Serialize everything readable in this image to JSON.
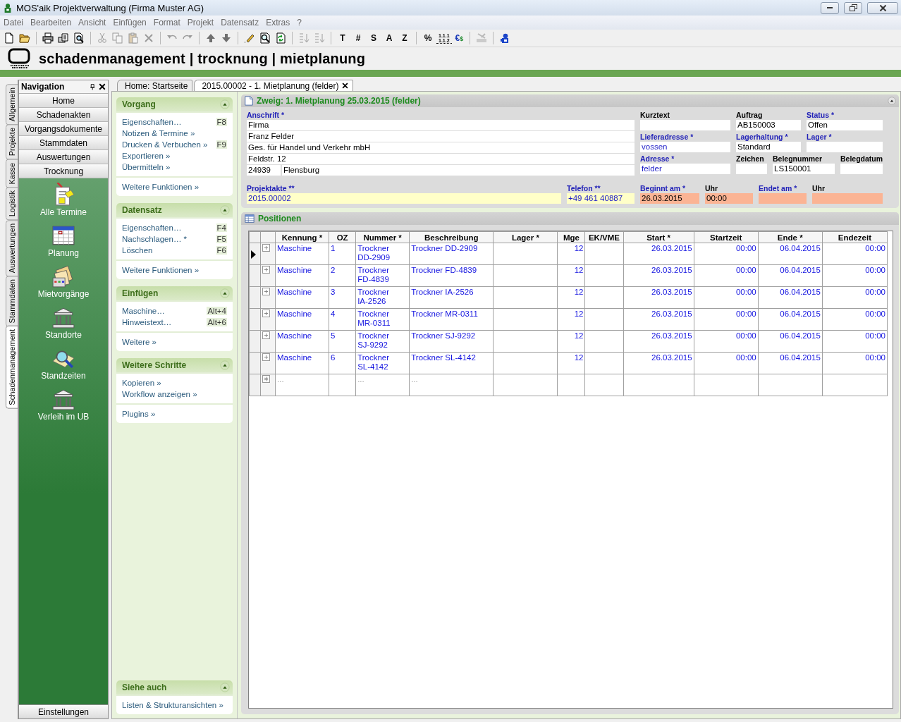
{
  "window": {
    "title": "MOS'aik Projektverwaltung (Firma Muster AG)"
  },
  "menu": [
    "Datei",
    "Bearbeiten",
    "Ansicht",
    "Einfügen",
    "Format",
    "Projekt",
    "Datensatz",
    "Extras",
    "?"
  ],
  "toolbar": [
    {
      "kind": "icon",
      "disabled": false
    },
    {
      "kind": "icon",
      "disabled": false
    },
    {
      "kind": "separator"
    },
    {
      "kind": "icon",
      "disabled": false
    },
    {
      "kind": "icon",
      "disabled": false
    },
    {
      "kind": "icon",
      "disabled": false
    },
    {
      "kind": "separator"
    },
    {
      "kind": "icon",
      "disabled": true
    },
    {
      "kind": "icon",
      "disabled": true
    },
    {
      "kind": "icon",
      "disabled": true
    },
    {
      "kind": "icon",
      "disabled": true
    },
    {
      "kind": "separator"
    },
    {
      "kind": "icon",
      "disabled": true
    },
    {
      "kind": "icon",
      "disabled": true
    },
    {
      "kind": "separator"
    },
    {
      "kind": "icon",
      "disabled": false
    },
    {
      "kind": "icon",
      "disabled": false
    },
    {
      "kind": "separator"
    },
    {
      "kind": "icon",
      "disabled": false
    },
    {
      "kind": "icon",
      "disabled": false
    },
    {
      "kind": "icon",
      "disabled": false
    },
    {
      "kind": "separator"
    },
    {
      "kind": "icon",
      "disabled": true
    },
    {
      "kind": "icon",
      "disabled": true
    },
    {
      "kind": "separator"
    },
    {
      "kind": "label",
      "text": "T",
      "disabled": false
    },
    {
      "kind": "label",
      "text": "#",
      "disabled": false
    },
    {
      "kind": "label",
      "text": "S",
      "disabled": false
    },
    {
      "kind": "label",
      "text": "A",
      "disabled": false
    },
    {
      "kind": "label",
      "text": "Z",
      "disabled": false
    },
    {
      "kind": "separator"
    },
    {
      "kind": "label",
      "text": "%",
      "disabled": false
    },
    {
      "kind": "stack",
      "lines": [
        "1.1.1",
        "1.1.2"
      ],
      "disabled": false
    },
    {
      "kind": "pair",
      "parts": [
        "€",
        "$"
      ],
      "disabled": false
    },
    {
      "kind": "separator"
    },
    {
      "kind": "icon",
      "disabled": true
    },
    {
      "kind": "separator"
    },
    {
      "kind": "icon",
      "disabled": false
    }
  ],
  "banner": {
    "title": "schadenmanagement | trocknung | mietplanung"
  },
  "side_tabs": [
    {
      "label": "Allgemein",
      "selected": false
    },
    {
      "label": "Projekte",
      "selected": false
    },
    {
      "label": "Kasse",
      "selected": false
    },
    {
      "label": "Logistik",
      "selected": false
    },
    {
      "label": "Auswertungen",
      "selected": false
    },
    {
      "label": "Stammdaten",
      "selected": false
    },
    {
      "label": "Schadenmanagement",
      "selected": true
    }
  ],
  "navigation": {
    "title": "Navigation",
    "buttons": [
      "Home",
      "Schadenakten",
      "Vorgangsdokumente",
      "Stammdaten",
      "Auswertungen",
      "Trocknung"
    ],
    "items": [
      "Alle Termine",
      "Planung",
      "Mietvorgänge",
      "Standorte",
      "Standzeiten",
      "Verleih im UB"
    ],
    "footer_button": "Einstellungen"
  },
  "doc_tabs": [
    {
      "label": "Home: Startseite",
      "selected": false
    },
    {
      "label": "2015.00002 - 1. Mietplanung (felder)",
      "selected": true
    }
  ],
  "taskpane": {
    "sections": [
      {
        "title": "Vorgang",
        "groups": [
          [
            {
              "label": "Eigenschaften…",
              "shortcut": "F8"
            },
            {
              "label": "Notizen & Termine »"
            },
            {
              "label": "Drucken & Verbuchen »",
              "shortcut": "F9"
            },
            {
              "label": "Exportieren »"
            },
            {
              "label": "Übermitteln »"
            }
          ],
          [
            {
              "label": "Weitere Funktionen »"
            }
          ]
        ]
      },
      {
        "title": "Datensatz",
        "groups": [
          [
            {
              "label": "Eigenschaften…",
              "shortcut": "F4"
            },
            {
              "label": "Nachschlagen… *",
              "shortcut": "F5"
            },
            {
              "label": "Löschen",
              "shortcut": "F6"
            }
          ],
          [
            {
              "label": "Weitere Funktionen »"
            }
          ]
        ]
      },
      {
        "title": "Einfügen",
        "groups": [
          [
            {
              "label": "Maschine…",
              "shortcut": "Alt+4"
            },
            {
              "label": "Hinweistext…",
              "shortcut": "Alt+6"
            }
          ],
          [
            {
              "label": "Weitere »"
            }
          ]
        ]
      },
      {
        "title": "Weitere Schritte",
        "groups": [
          [
            {
              "label": "Kopieren »"
            },
            {
              "label": "Workflow anzeigen »"
            }
          ],
          [
            {
              "label": "Plugins »"
            }
          ]
        ]
      }
    ],
    "footer_section": {
      "title": "Siehe auch",
      "groups": [
        [
          {
            "label": "Listen & Strukturansichten »"
          }
        ]
      ]
    }
  },
  "form": {
    "title": "Zweig: 1. Mietplanung 25.03.2015 (felder)",
    "address": {
      "label": "Anschrift *",
      "required": true,
      "lines": [
        "Firma",
        "Franz Felder",
        "Ges. für Handel und Verkehr mbH",
        "Feldstr. 12"
      ],
      "postcode": "24939",
      "city": "Flensburg"
    },
    "right_rows": [
      [
        {
          "label": "Kurztext",
          "required": false
        },
        {
          "label": "Auftrag",
          "required": false,
          "value": "AB150003"
        },
        {
          "label": "Status *",
          "required": true,
          "value": "Offen"
        }
      ],
      [
        {
          "label": "Lieferadresse *",
          "required": true,
          "value": "vossen",
          "link": true
        },
        {
          "label": "Lagerhaltung *",
          "required": true,
          "value": "Standard"
        },
        {
          "label": "Lager *",
          "required": true
        }
      ],
      [
        {
          "label": "Adresse *",
          "required": true,
          "value": "felder",
          "link": true
        },
        {
          "label": "Zeichen",
          "required": false
        },
        {
          "label": "Belegnummer",
          "required": false,
          "value": "LS150001"
        },
        {
          "label": "Belegdatum",
          "required": false
        }
      ]
    ],
    "bottom_row": [
      {
        "label": "Projektakte **",
        "required": true,
        "value": "2015.00002",
        "link": true,
        "color": "#ffffc8"
      },
      {
        "label": "Telefon **",
        "required": true,
        "value": "+49 461 40887",
        "link": true,
        "color": "#ffffc8"
      },
      {
        "label": "Beginnt am *",
        "required": true,
        "value": "26.03.2015",
        "color": "#fbb494"
      },
      {
        "label": "Uhr",
        "required": false,
        "value": "00:00",
        "color": "#fbb494"
      },
      {
        "label": "Endet am *",
        "required": true,
        "color": "#fbb494"
      },
      {
        "label": "Uhr",
        "required": false,
        "color": "#fbb494"
      }
    ]
  },
  "positions": {
    "title": "Positionen",
    "columns": [
      "Kennung *",
      "OZ",
      "Nummer *",
      "Beschreibung",
      "Lager *",
      "Mge",
      "EK/VME",
      "Start *",
      "Startzeit",
      "Ende *",
      "Endezeit"
    ],
    "rows": [
      {
        "kind": "item",
        "selected": true,
        "cells": [
          "Maschine",
          "1",
          "Trockner DD-2909",
          "Trockner DD-2909",
          null,
          "12",
          null,
          "26.03.2015",
          "00:00",
          "06.04.2015",
          "00:00"
        ]
      },
      {
        "kind": "item",
        "selected": false,
        "cells": [
          "Maschine",
          "2",
          "Trockner FD-4839",
          "Trockner FD-4839",
          null,
          "12",
          null,
          "26.03.2015",
          "00:00",
          "06.04.2015",
          "00:00"
        ]
      },
      {
        "kind": "item",
        "selected": false,
        "cells": [
          "Maschine",
          "3",
          "Trockner IA-2526",
          "Trockner IA-2526",
          null,
          "12",
          null,
          "26.03.2015",
          "00:00",
          "06.04.2015",
          "00:00"
        ]
      },
      {
        "kind": "item",
        "selected": false,
        "cells": [
          "Maschine",
          "4",
          "Trockner MR-0311",
          "Trockner MR-0311",
          null,
          "12",
          null,
          "26.03.2015",
          "00:00",
          "06.04.2015",
          "00:00"
        ]
      },
      {
        "kind": "item",
        "selected": false,
        "cells": [
          "Maschine",
          "5",
          "Trockner SJ-9292",
          "Trockner SJ-9292",
          null,
          "12",
          null,
          "26.03.2015",
          "00:00",
          "06.04.2015",
          "00:00"
        ]
      },
      {
        "kind": "item",
        "selected": false,
        "cells": [
          "Maschine",
          "6",
          "Trockner SL-4142",
          "Trockner SL-4142",
          null,
          "12",
          null,
          "26.03.2015",
          "00:00",
          "06.04.2015",
          "00:00"
        ]
      },
      {
        "kind": "new",
        "selected": false,
        "cells": [
          "...",
          null,
          "...",
          "...",
          null,
          null,
          null,
          null,
          null,
          null,
          null
        ]
      }
    ]
  }
}
